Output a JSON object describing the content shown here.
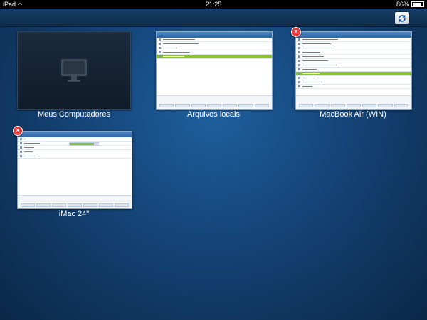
{
  "status_bar": {
    "device": "iPad",
    "time": "21:25",
    "battery": "86%",
    "battery_level": 0.86
  },
  "tiles": [
    {
      "caption": "Meus Computadores"
    },
    {
      "caption": "Arquivos locais"
    },
    {
      "caption": "MacBook Air (WIN)"
    },
    {
      "caption": "iMac 24\""
    }
  ],
  "icons": {
    "sync": "sync-icon",
    "close": "close-icon",
    "monitor": "monitor-icon",
    "wifi": "wifi-icon"
  }
}
